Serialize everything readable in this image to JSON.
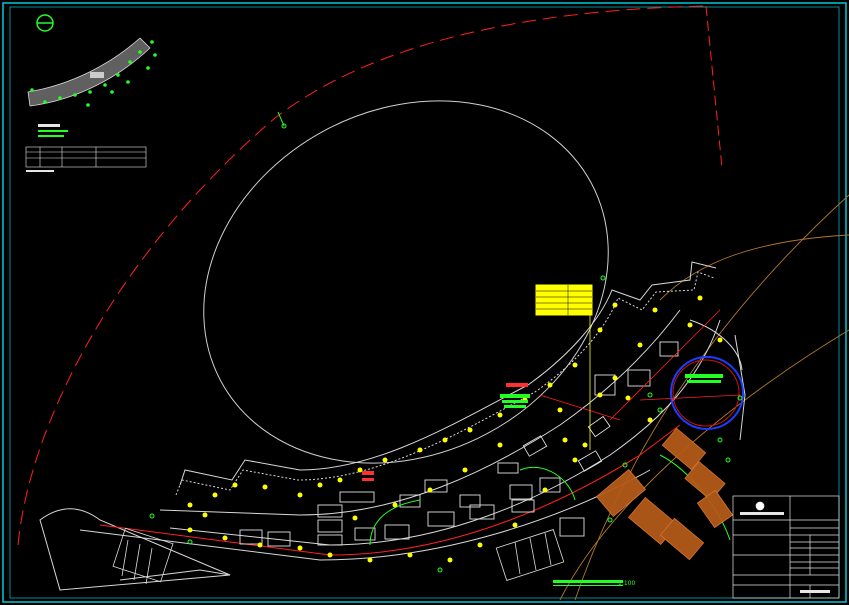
{
  "drawing": {
    "scale_label": "1:100",
    "colors": {
      "background": "#000000",
      "frame": "#00ffff",
      "boundary": "#ff2020",
      "plaza": "#d8d8d8",
      "lamp": "#ffff00",
      "annotation": "#22ff22",
      "deck": "#c8641e",
      "road": "#b0782a",
      "ring": "#1e3cff"
    },
    "icons": [
      "north-arrow-icon",
      "lamp-icon",
      "tree-icon"
    ]
  }
}
